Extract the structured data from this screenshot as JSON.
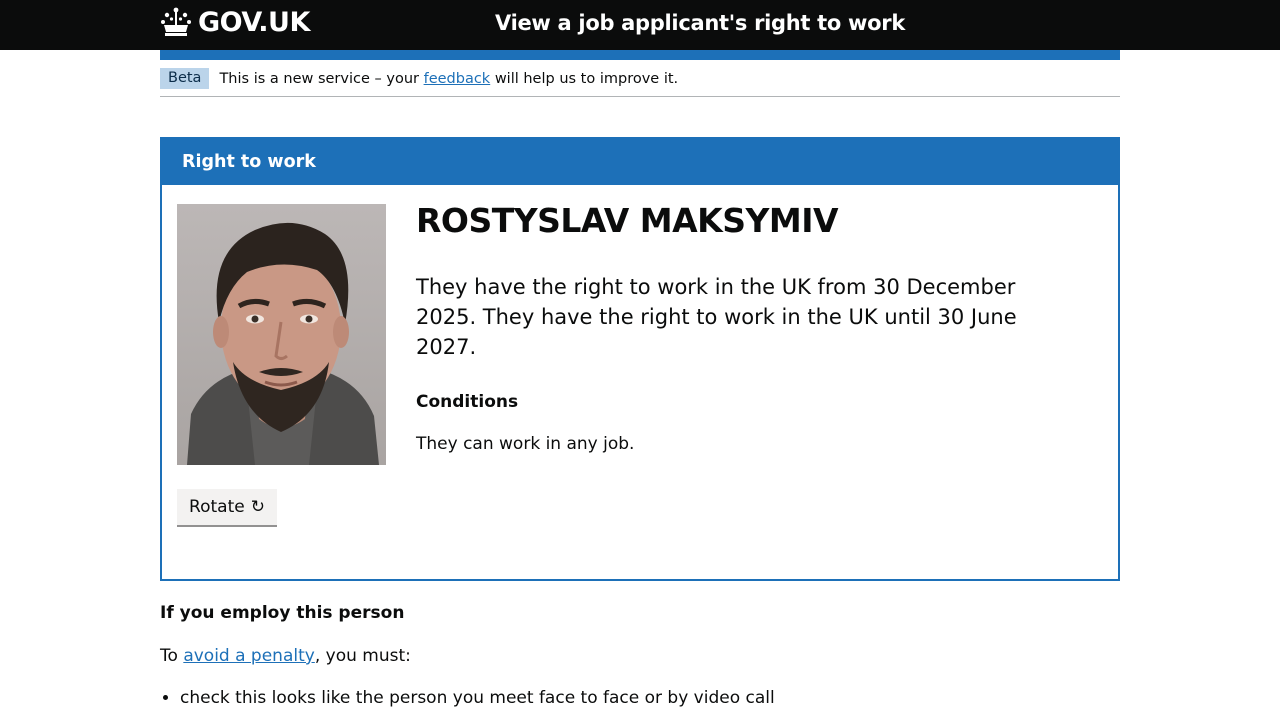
{
  "header": {
    "logo_text": "GOV.UK",
    "service_name": "View a job applicant's right to work"
  },
  "phase_banner": {
    "tag": "Beta",
    "text_before": "This is a new service – your",
    "link": "feedback",
    "text_after": "will help us to improve it."
  },
  "panel": {
    "title": "Right to work",
    "name": "ROSTYSLAV MAKSYMIV",
    "summary": "They have the right to work in the UK from 30 December 2025. They have the right to work in the UK until 30 June 2027.",
    "conditions_heading": "Conditions",
    "conditions_text": "They can work in any job.",
    "rotate_label": "Rotate",
    "rotate_glyph": "↻",
    "photo_alt": "Photo of ROSTYSLAV MAKSYMIV"
  },
  "employ": {
    "heading": "If you employ this person",
    "intro_before": "To",
    "intro_link": "avoid a penalty",
    "intro_after": ", you must:",
    "items": [
      "check this looks like the person you meet face to face or by video call"
    ]
  },
  "colors": {
    "brand_blue": "#1d70b8",
    "header_black": "#0b0c0c",
    "tag_bg": "#bbd4ea"
  }
}
